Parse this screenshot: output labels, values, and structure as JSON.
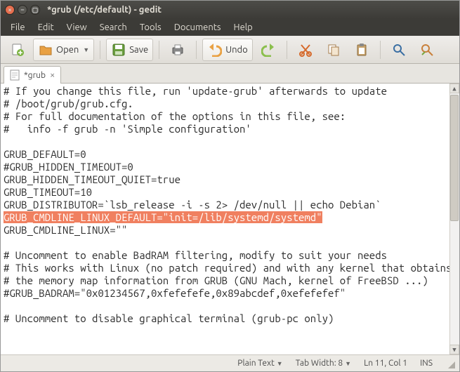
{
  "window": {
    "title": "*grub (/etc/default) - gedit"
  },
  "menubar": {
    "items": [
      "File",
      "Edit",
      "View",
      "Search",
      "Tools",
      "Documents",
      "Help"
    ]
  },
  "toolbar": {
    "new_label": "",
    "open_label": "Open",
    "save_label": "Save",
    "undo_label": "Undo"
  },
  "tabs": {
    "items": [
      {
        "label": "*grub"
      }
    ]
  },
  "editor": {
    "lines": [
      "# If you change this file, run 'update-grub' afterwards to update",
      "# /boot/grub/grub.cfg.",
      "# For full documentation of the options in this file, see:",
      "#   info -f grub -n 'Simple configuration'",
      "",
      "GRUB_DEFAULT=0",
      "#GRUB_HIDDEN_TIMEOUT=0",
      "GRUB_HIDDEN_TIMEOUT_QUIET=true",
      "GRUB_TIMEOUT=10",
      "GRUB_DISTRIBUTOR=`lsb_release -i -s 2> /dev/null || echo Debian`"
    ],
    "highlighted_line": "GRUB_CMDLINE_LINUX_DEFAULT=\"init=/lib/systemd/systemd\"",
    "lines_after": [
      "GRUB_CMDLINE_LINUX=\"\"",
      "",
      "# Uncomment to enable BadRAM filtering, modify to suit your needs",
      "# This works with Linux (no patch required) and with any kernel that obtains",
      "# the memory map information from GRUB (GNU Mach, kernel of FreeBSD ...)",
      "#GRUB_BADRAM=\"0x01234567,0xfefefefe,0x89abcdef,0xefefefef\"",
      "",
      "# Uncomment to disable graphical terminal (grub-pc only)"
    ]
  },
  "statusbar": {
    "syntax": "Plain Text",
    "tabwidth": "Tab Width: 8",
    "position": "Ln 11, Col 1",
    "insert_mode": "INS"
  }
}
